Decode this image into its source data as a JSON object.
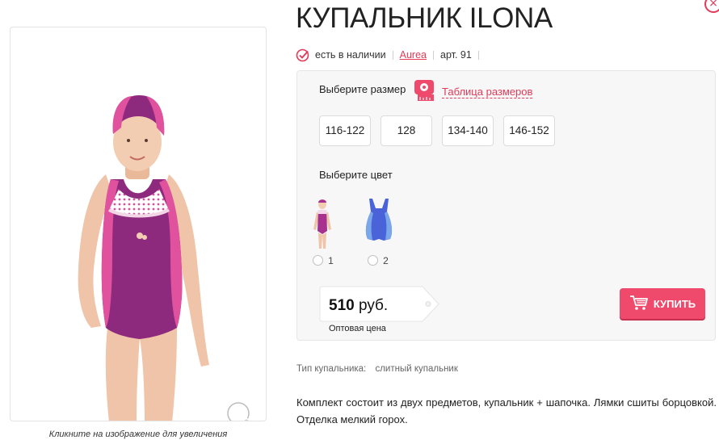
{
  "product": {
    "title": "КУПАЛЬНИК ILONA",
    "availability": "есть в наличии",
    "brand": "Aurea",
    "article": "арт. 91"
  },
  "gallery": {
    "zoom_caption": "Кликните на изображение для увеличения"
  },
  "options": {
    "size_label": "Выберите размер",
    "size_table_link": "Таблица размеров",
    "sizes": [
      "116-122",
      "128",
      "134-140",
      "146-152"
    ],
    "color_label": "Выберите цвет",
    "colors": [
      {
        "label": "1",
        "swatch": "#a8318f"
      },
      {
        "label": "2",
        "swatch": "#4a63d8"
      }
    ]
  },
  "price": {
    "amount": "510",
    "currency": "руб.",
    "note": "Оптовая цена"
  },
  "buy_button": {
    "label": "КУПИТЬ"
  },
  "specs": {
    "type_label": "Тип купальника:",
    "type_value": "слитный купальник"
  },
  "description": "Комплект состоит из двух предметов, купальник + шапочка. Лямки сшиты борцовкой. Отделка мелкий горох.",
  "colors": {
    "accent": "#e23a58",
    "buy": "#ef4a6b",
    "suit_purple": "#8e2a7e",
    "suit_pink": "#e0529e"
  }
}
